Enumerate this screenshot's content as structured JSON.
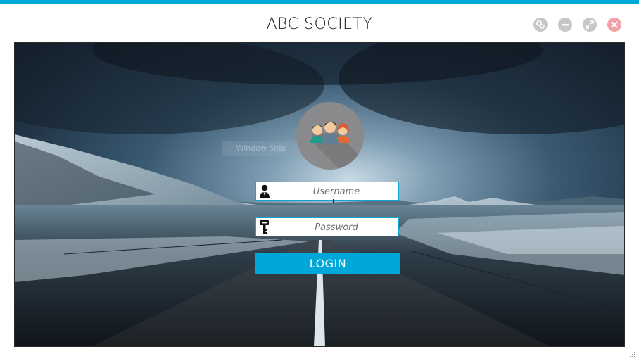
{
  "window": {
    "title": "ABC SOCIETY",
    "controls": [
      {
        "name": "settings-icon"
      },
      {
        "name": "minimize-icon"
      },
      {
        "name": "maximize-icon"
      },
      {
        "name": "close-icon"
      }
    ]
  },
  "ghost_overlay": {
    "label": "Window Snip"
  },
  "login_form": {
    "avatar_icon": "users-group-icon",
    "username": {
      "icon": "user-icon",
      "placeholder": "Username",
      "value": ""
    },
    "password": {
      "icon": "key-icon",
      "placeholder": "Password",
      "value": ""
    },
    "login_label": "LOGIN"
  },
  "colors": {
    "accent": "#00a7d9",
    "close": "#f0a3a8",
    "control": "#c7c7c7"
  }
}
